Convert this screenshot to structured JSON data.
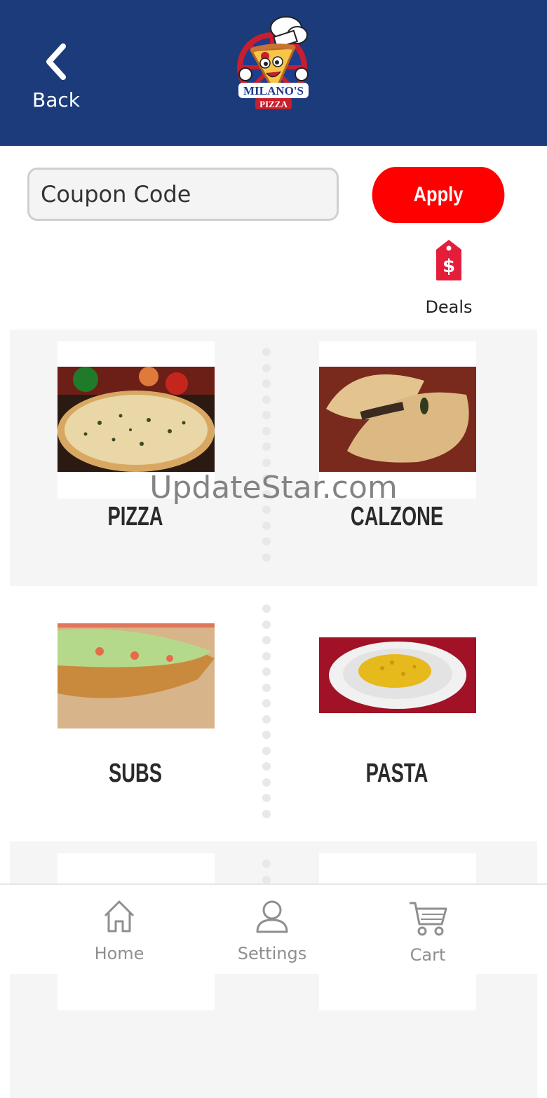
{
  "header": {
    "back_label": "Back",
    "logo_text_top": "MILANO'S",
    "logo_text_bottom": "PIZZA"
  },
  "coupon": {
    "placeholder": "Coupon Code",
    "apply_label": "Apply"
  },
  "deals": {
    "label": "Deals",
    "icon": "price-tag-icon"
  },
  "categories": [
    {
      "label": "PIZZA"
    },
    {
      "label": "CALZONE"
    },
    {
      "label": "SUBS"
    },
    {
      "label": "PASTA"
    }
  ],
  "watermark": "UpdateStar.com",
  "tabbar": {
    "items": [
      {
        "label": "Home",
        "icon": "home-icon"
      },
      {
        "label": "Settings",
        "icon": "user-icon"
      },
      {
        "label": "Cart",
        "icon": "cart-icon"
      }
    ]
  },
  "colors": {
    "header_bg": "#1b3b7a",
    "accent_red": "#ff0000",
    "tab_gray": "#8f8f8f"
  }
}
